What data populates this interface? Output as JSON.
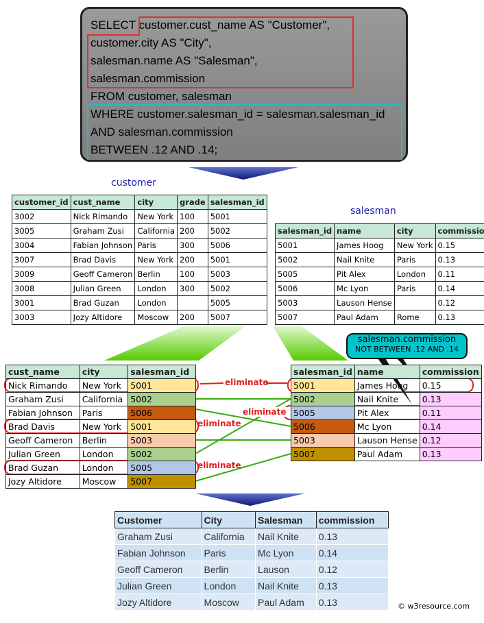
{
  "sql": [
    "SELECT customer.cust_name AS \"Customer\",",
    "customer.city AS \"City\",",
    "salesman.name AS \"Salesman\",",
    "salesman.commission",
    "FROM customer, salesman",
    "WHERE customer.salesman_id = salesman.salesman_id",
    "AND salesman.commission",
    "BETWEEN .12 AND .14;"
  ],
  "customer": {
    "label": "customer",
    "headers": [
      "customer_id",
      "cust_name",
      "city",
      "grade",
      "salesman_id"
    ],
    "rows": [
      [
        "3002",
        "Nick Rimando",
        "New York",
        "100",
        "5001"
      ],
      [
        "3005",
        "Graham Zusi",
        "California",
        "200",
        "5002"
      ],
      [
        "3004",
        "Fabian Johnson",
        "Paris",
        "300",
        "5006"
      ],
      [
        "3007",
        "Brad Davis",
        "New York",
        "200",
        "5001"
      ],
      [
        "3009",
        "Geoff Cameron",
        "Berlin",
        "100",
        "5003"
      ],
      [
        "3008",
        "Julian Green",
        "London",
        "300",
        "5002"
      ],
      [
        "3001",
        "Brad Guzan",
        "London",
        "",
        "5005"
      ],
      [
        "3003",
        "Jozy Altidore",
        "Moscow",
        "200",
        "5007"
      ]
    ]
  },
  "salesman": {
    "label": "salesman",
    "headers": [
      "salesman_id",
      "name",
      "city",
      "commission"
    ],
    "rows": [
      [
        "5001",
        "James Hoog",
        "New York",
        "0.15"
      ],
      [
        "5002",
        "Nail Knite",
        "Paris",
        "0.13"
      ],
      [
        "5005",
        "Pit Alex",
        "London",
        "0.11"
      ],
      [
        "5006",
        "Mc Lyon",
        "Paris",
        "0.14"
      ],
      [
        "5003",
        "Lauson Hense",
        "",
        "0.12"
      ],
      [
        "5007",
        "Paul Adam",
        "Rome",
        "0.13"
      ]
    ]
  },
  "left_join": {
    "headers": [
      "cust_name",
      "city",
      "salesman_id"
    ],
    "rows": [
      [
        "Nick Rimando",
        "New York",
        "5001"
      ],
      [
        "Graham Zusi",
        "California",
        "5002"
      ],
      [
        "Fabian Johnson",
        "Paris",
        "5006"
      ],
      [
        "Brad Davis",
        "New York",
        "5001"
      ],
      [
        "Geoff Cameron",
        "Berlin",
        "5003"
      ],
      [
        "Julian Green",
        "London",
        "5002"
      ],
      [
        "Brad Guzan",
        "London",
        "5005"
      ],
      [
        "Jozy Altidore",
        "Moscow",
        "5007"
      ]
    ]
  },
  "right_join": {
    "headers": [
      "salesman_id",
      "name",
      "commission"
    ],
    "rows": [
      [
        "5001",
        "James Hoog",
        "0.15"
      ],
      [
        "5002",
        "Nail Knite",
        "0.13"
      ],
      [
        "5005",
        "Pit Alex",
        "0.11"
      ],
      [
        "5006",
        "Mc Lyon",
        "0.14"
      ],
      [
        "5003",
        "Lauson Hense",
        "0.12"
      ],
      [
        "5007",
        "Paul Adam",
        "0.13"
      ]
    ]
  },
  "callout": [
    "salesman.commission",
    "NOT BETWEEN .12 AND .14"
  ],
  "eliminate": "eliminate",
  "id_colors": {
    "5001": "#ffe699",
    "5002": "#a9d08e",
    "5006": "#c55a11",
    "5003": "#f8cbad",
    "5005": "#b4c6e7",
    "5007": "#bf9000"
  },
  "commission_color": "#ffccff",
  "result": {
    "headers": [
      "Customer",
      "City",
      "Salesman",
      "commission"
    ],
    "rows": [
      [
        "Graham Zusi",
        "California",
        "Nail Knite",
        "0.13"
      ],
      [
        "Fabian Johnson",
        "Paris",
        "Mc Lyon",
        "0.14"
      ],
      [
        "Geoff Cameron",
        "Berlin",
        "Lauson",
        "0.12"
      ],
      [
        "Julian Green",
        "London",
        "Nail Knite",
        "0.13"
      ],
      [
        "Jozy Altidore",
        "Moscow",
        "Paul Adam",
        "0.13"
      ]
    ]
  },
  "copyright": "© w3resource.com"
}
